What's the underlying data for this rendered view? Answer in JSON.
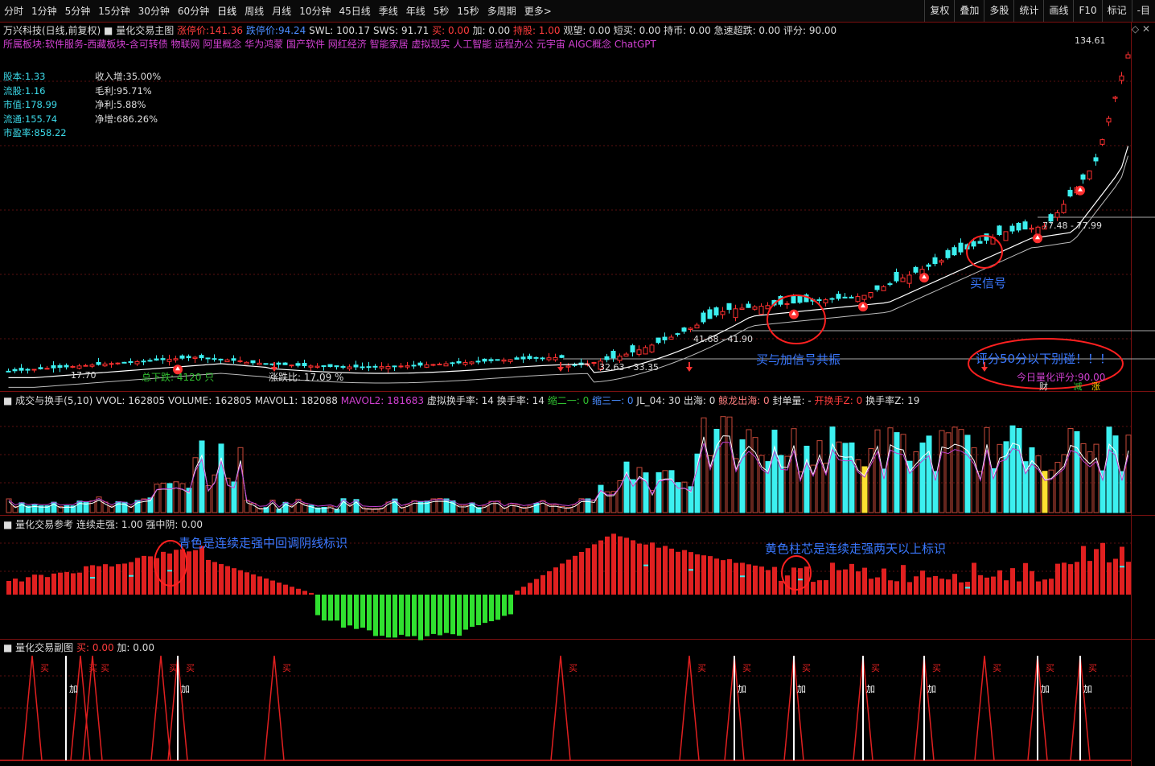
{
  "toolbar": {
    "periods": [
      "分时",
      "1分钟",
      "5分钟",
      "15分钟",
      "30分钟",
      "60分钟",
      "日线",
      "周线",
      "月线",
      "10分钟",
      "45日线",
      "季线",
      "年线",
      "5秒",
      "15秒",
      "多周期",
      "更多>"
    ],
    "active_period": "日线",
    "right_buttons": [
      "复权",
      "叠加",
      "多股",
      "统计",
      "画线",
      "F10",
      "标记",
      "-目"
    ]
  },
  "header": {
    "stock_name": "万兴科技(日线,前复权)",
    "indicator_name": "量化交易主图",
    "limit_up_label": "涨停价:",
    "limit_up_value": "141.36",
    "limit_down_label": "跌停价:",
    "limit_down_value": "94.24",
    "swl": "SWL: 100.17",
    "sws": "SWS: 91.71",
    "buy": "买: 0.00",
    "add": "加: 0.00",
    "hold": "持股: 1.00",
    "watch": "观望: 0.00",
    "short_buy": "短买: 0.00",
    "hold_coin": "持币: 0.00",
    "rapid": "急速超跌: 0.00",
    "score": "评分: 90.00"
  },
  "sectors": "所属板块:软件服务-西藏板块-含可转债 物联网 阿里概念 华为鸿蒙 国产软件 网红经济 智能家居 虚拟现实 人工智能 远程办公 元宇宙 AIGC概念 ChatGPT",
  "fundamentals_left": [
    "股本:1.33",
    "流股:1.16",
    "市值:178.99",
    "流通:155.74",
    "市盈率:858.22"
  ],
  "fundamentals_right": [
    "收入增:35.00%",
    "毛利:95.71%",
    "净利:5.88%",
    "净增:686.26%"
  ],
  "main_annotations": {
    "price_high": "134.61",
    "band1": "41.68 - 41.90",
    "band2": "32.63 - 33.35",
    "band3": "77.48 - 77.99",
    "low_label": "17.70",
    "total_down": "总下跌: 4120 只",
    "updown_ratio": "涨跌比: 17.09 %",
    "resonance": "买与加信号共振",
    "buy_signal": "买信号",
    "warning": "评分50分以下别碰！！！",
    "today_score": "今日量化评分:90.00",
    "tags": [
      "财",
      "减",
      "涨"
    ]
  },
  "volume_panel": {
    "title": "成交与换手(5,10)",
    "vvol": "VVOL: 162805",
    "volume": "VOLUME: 162805",
    "mavol1": "MAVOL1: 182088",
    "mavol2": "MAVOL2: 181683",
    "virtual_turnover": "虚拟换手率: 14",
    "turnover": "换手率: 14",
    "shrink2": "缩二一: 0",
    "shrink3": "缩三一: 0",
    "jl04": "JL_04: 30",
    "outsea": "出海: 0",
    "dragon": "鲸龙出海: 0",
    "seal": "封单量: -",
    "open_turnover": "开换手Z: 0",
    "turnover_z": "换手率Z: 19"
  },
  "ref_panel": {
    "title": "量化交易参考",
    "trend": "连续走强: 1.00",
    "mid_yin": "强中阴: 0.00",
    "note_cyan": "青色是连续走强中回调阴线标识",
    "note_yellow": "黄色柱芯是连续走强两天以上标识"
  },
  "sub_panel": {
    "title": "量化交易副图",
    "buy": "买: 0.00",
    "add": "加: 0.00",
    "buy_label": "买",
    "add_label": "加"
  },
  "colors": {
    "up": "#ff3030",
    "down": "#3cf0f0",
    "green": "#30e030",
    "annotation": "#3a78ff",
    "circle": "#ff2020"
  }
}
